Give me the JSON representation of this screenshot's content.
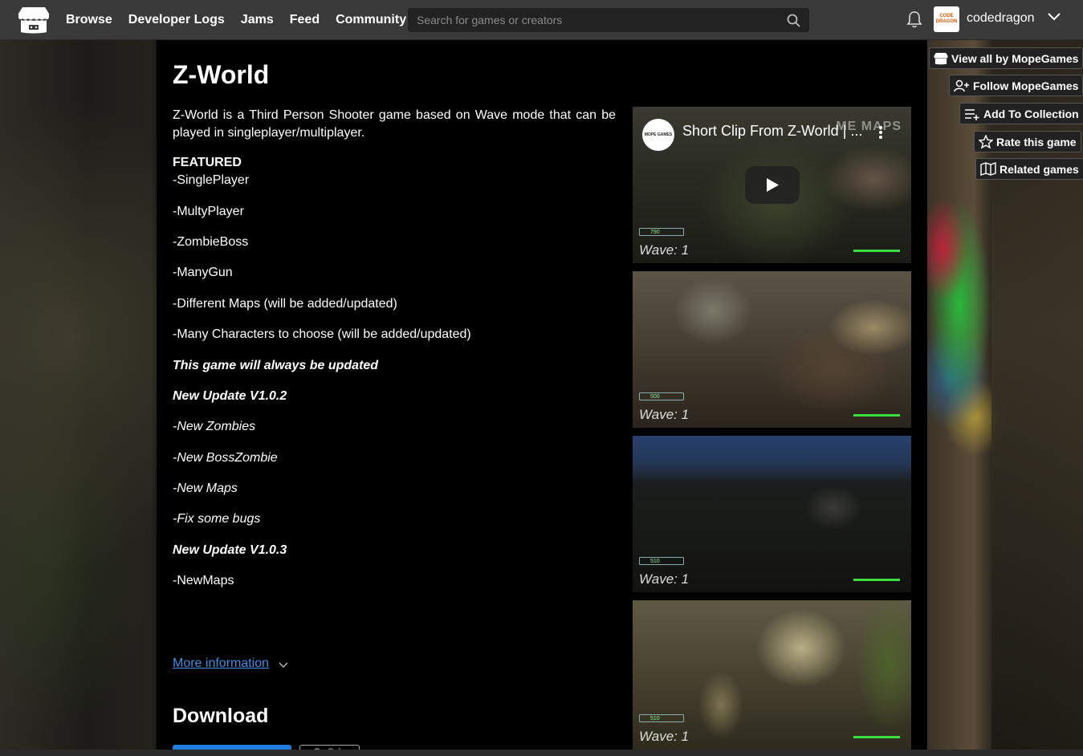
{
  "nav": {
    "links": [
      "Browse",
      "Developer Logs",
      "Jams",
      "Feed",
      "Community"
    ],
    "search_placeholder": "Search for games or creators",
    "username": "codedragon",
    "avatar_text": [
      "CODE",
      "DRAGON"
    ]
  },
  "game": {
    "title": "Z-World",
    "description": "Z-World is a Third Person Shooter game based on Wave mode that can be played in singleplayer/multiplayer.",
    "featured_heading": "FEATURED",
    "featured_items": [
      "-SinglePlayer",
      "-MultyPlayer",
      "-ZombieBoss",
      "-ManyGun",
      "-Different Maps (will be added/updated)",
      "-Many Characters to choose (will be added/updated)"
    ],
    "always_updated": "This game will always be updated",
    "update_102": {
      "heading": "New Update V1.0.2",
      "items": [
        "-New Zombies",
        "-New BossZombie",
        "-New Maps",
        "-Fix some bugs"
      ]
    },
    "update_103": {
      "heading": "New Update V1.0.3",
      "items": [
        "-NewMaps"
      ]
    },
    "more_info": "More information",
    "download_heading": "Download",
    "download_button2": "On Sale"
  },
  "media": {
    "video_title": "Short Clip From Z-World | ...",
    "video_channel": "MOPE GAMES",
    "watermark": "ME MAPS",
    "shots": [
      {
        "wave": "Wave: 1",
        "hud": "790"
      },
      {
        "wave": "Wave: 1",
        "hud": "500"
      },
      {
        "wave": "Wave: 1",
        "hud": "510"
      },
      {
        "wave": "Wave: 1",
        "hud": "510"
      }
    ]
  },
  "sidebar": {
    "view_all": "View all by MopeGames",
    "follow": "Follow MopeGames",
    "add_collection": "Add To Collection",
    "rate": "Rate this game",
    "related": "Related games"
  },
  "colors": {
    "link": "#3d8ee6",
    "download_button": "#1f7de0",
    "topnav": "#3a3a3a"
  }
}
